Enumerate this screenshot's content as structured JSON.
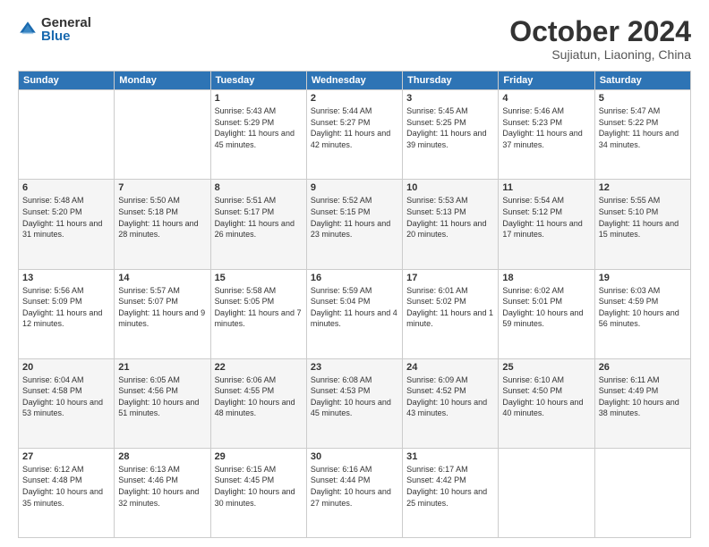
{
  "header": {
    "logo": {
      "general": "General",
      "blue": "Blue"
    },
    "title": "October 2024",
    "subtitle": "Sujiatun, Liaoning, China"
  },
  "days_of_week": [
    "Sunday",
    "Monday",
    "Tuesday",
    "Wednesday",
    "Thursday",
    "Friday",
    "Saturday"
  ],
  "weeks": [
    [
      {
        "day": "",
        "info": ""
      },
      {
        "day": "",
        "info": ""
      },
      {
        "day": "1",
        "info": "Sunrise: 5:43 AM\nSunset: 5:29 PM\nDaylight: 11 hours and 45 minutes."
      },
      {
        "day": "2",
        "info": "Sunrise: 5:44 AM\nSunset: 5:27 PM\nDaylight: 11 hours and 42 minutes."
      },
      {
        "day": "3",
        "info": "Sunrise: 5:45 AM\nSunset: 5:25 PM\nDaylight: 11 hours and 39 minutes."
      },
      {
        "day": "4",
        "info": "Sunrise: 5:46 AM\nSunset: 5:23 PM\nDaylight: 11 hours and 37 minutes."
      },
      {
        "day": "5",
        "info": "Sunrise: 5:47 AM\nSunset: 5:22 PM\nDaylight: 11 hours and 34 minutes."
      }
    ],
    [
      {
        "day": "6",
        "info": "Sunrise: 5:48 AM\nSunset: 5:20 PM\nDaylight: 11 hours and 31 minutes."
      },
      {
        "day": "7",
        "info": "Sunrise: 5:50 AM\nSunset: 5:18 PM\nDaylight: 11 hours and 28 minutes."
      },
      {
        "day": "8",
        "info": "Sunrise: 5:51 AM\nSunset: 5:17 PM\nDaylight: 11 hours and 26 minutes."
      },
      {
        "day": "9",
        "info": "Sunrise: 5:52 AM\nSunset: 5:15 PM\nDaylight: 11 hours and 23 minutes."
      },
      {
        "day": "10",
        "info": "Sunrise: 5:53 AM\nSunset: 5:13 PM\nDaylight: 11 hours and 20 minutes."
      },
      {
        "day": "11",
        "info": "Sunrise: 5:54 AM\nSunset: 5:12 PM\nDaylight: 11 hours and 17 minutes."
      },
      {
        "day": "12",
        "info": "Sunrise: 5:55 AM\nSunset: 5:10 PM\nDaylight: 11 hours and 15 minutes."
      }
    ],
    [
      {
        "day": "13",
        "info": "Sunrise: 5:56 AM\nSunset: 5:09 PM\nDaylight: 11 hours and 12 minutes."
      },
      {
        "day": "14",
        "info": "Sunrise: 5:57 AM\nSunset: 5:07 PM\nDaylight: 11 hours and 9 minutes."
      },
      {
        "day": "15",
        "info": "Sunrise: 5:58 AM\nSunset: 5:05 PM\nDaylight: 11 hours and 7 minutes."
      },
      {
        "day": "16",
        "info": "Sunrise: 5:59 AM\nSunset: 5:04 PM\nDaylight: 11 hours and 4 minutes."
      },
      {
        "day": "17",
        "info": "Sunrise: 6:01 AM\nSunset: 5:02 PM\nDaylight: 11 hours and 1 minute."
      },
      {
        "day": "18",
        "info": "Sunrise: 6:02 AM\nSunset: 5:01 PM\nDaylight: 10 hours and 59 minutes."
      },
      {
        "day": "19",
        "info": "Sunrise: 6:03 AM\nSunset: 4:59 PM\nDaylight: 10 hours and 56 minutes."
      }
    ],
    [
      {
        "day": "20",
        "info": "Sunrise: 6:04 AM\nSunset: 4:58 PM\nDaylight: 10 hours and 53 minutes."
      },
      {
        "day": "21",
        "info": "Sunrise: 6:05 AM\nSunset: 4:56 PM\nDaylight: 10 hours and 51 minutes."
      },
      {
        "day": "22",
        "info": "Sunrise: 6:06 AM\nSunset: 4:55 PM\nDaylight: 10 hours and 48 minutes."
      },
      {
        "day": "23",
        "info": "Sunrise: 6:08 AM\nSunset: 4:53 PM\nDaylight: 10 hours and 45 minutes."
      },
      {
        "day": "24",
        "info": "Sunrise: 6:09 AM\nSunset: 4:52 PM\nDaylight: 10 hours and 43 minutes."
      },
      {
        "day": "25",
        "info": "Sunrise: 6:10 AM\nSunset: 4:50 PM\nDaylight: 10 hours and 40 minutes."
      },
      {
        "day": "26",
        "info": "Sunrise: 6:11 AM\nSunset: 4:49 PM\nDaylight: 10 hours and 38 minutes."
      }
    ],
    [
      {
        "day": "27",
        "info": "Sunrise: 6:12 AM\nSunset: 4:48 PM\nDaylight: 10 hours and 35 minutes."
      },
      {
        "day": "28",
        "info": "Sunrise: 6:13 AM\nSunset: 4:46 PM\nDaylight: 10 hours and 32 minutes."
      },
      {
        "day": "29",
        "info": "Sunrise: 6:15 AM\nSunset: 4:45 PM\nDaylight: 10 hours and 30 minutes."
      },
      {
        "day": "30",
        "info": "Sunrise: 6:16 AM\nSunset: 4:44 PM\nDaylight: 10 hours and 27 minutes."
      },
      {
        "day": "31",
        "info": "Sunrise: 6:17 AM\nSunset: 4:42 PM\nDaylight: 10 hours and 25 minutes."
      },
      {
        "day": "",
        "info": ""
      },
      {
        "day": "",
        "info": ""
      }
    ]
  ]
}
